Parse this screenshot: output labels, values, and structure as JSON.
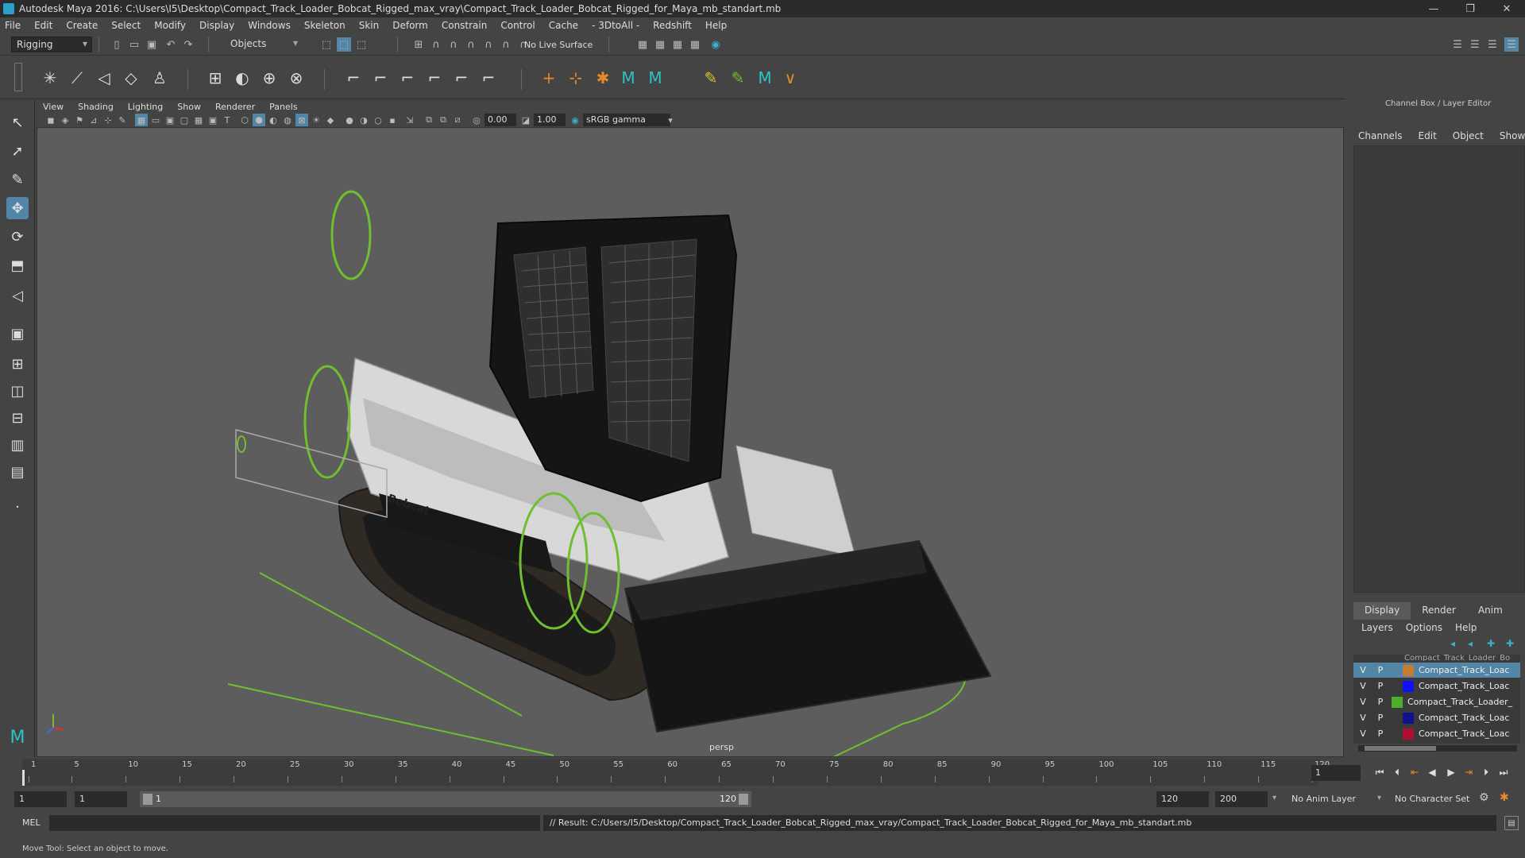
{
  "window": {
    "title": "Autodesk Maya 2016: C:\\Users\\I5\\Desktop\\Compact_Track_Loader_Bobcat_Rigged_max_vray\\Compact_Track_Loader_Bobcat_Rigged_for_Maya_mb_standart.mb",
    "controls": [
      "—",
      "❐",
      "✕"
    ]
  },
  "menubar": [
    "File",
    "Edit",
    "Create",
    "Select",
    "Modify",
    "Display",
    "Windows",
    "Skeleton",
    "Skin",
    "Deform",
    "Constrain",
    "Control",
    "Cache",
    "- 3DtoAll -",
    "Redshift",
    "Help"
  ],
  "statusline": {
    "menuset": "Rigging",
    "selection_mode": "Objects",
    "live_surface": "No Live Surface"
  },
  "panel": {
    "menu": [
      "View",
      "Shading",
      "Lighting",
      "Show",
      "Renderer",
      "Panels"
    ],
    "exposure": "0.00",
    "gamma": "1.00",
    "colorspace": "sRGB gamma",
    "camera": "persp"
  },
  "viewport": {
    "logo_text": "Bobcat"
  },
  "channelbox": {
    "header": "Channel Box / Layer Editor",
    "menu": [
      "Channels",
      "Edit",
      "Object",
      "Show"
    ]
  },
  "layereditor": {
    "tabs": [
      "Display",
      "Render",
      "Anim"
    ],
    "menu": [
      "Layers",
      "Options",
      "Help"
    ],
    "layers": [
      {
        "v": "V",
        "p": "P",
        "color": "#c87a32",
        "name": "Compact_Track_Loac",
        "selected": true
      },
      {
        "v": "V",
        "p": "P",
        "color": "#1010ff",
        "name": "Compact_Track_Loac",
        "selected": false
      },
      {
        "v": "V",
        "p": "P",
        "color": "#4caf2a",
        "name": "Compact_Track_Loader_",
        "selected": false
      },
      {
        "v": "V",
        "p": "P",
        "color": "#101090",
        "name": "Compact_Track_Loac",
        "selected": false
      },
      {
        "v": "V",
        "p": "P",
        "color": "#b01030",
        "name": "Compact_Track_Loac",
        "selected": false
      }
    ],
    "partial_row": "Compact_Track_Loader_Bo"
  },
  "timeslider": {
    "ticks": [
      "1",
      "5",
      "10",
      "15",
      "20",
      "25",
      "30",
      "35",
      "40",
      "45",
      "50",
      "55",
      "60",
      "65",
      "70",
      "75",
      "80",
      "85",
      "90",
      "95",
      "100",
      "105",
      "110",
      "115",
      "120"
    ],
    "current_frame": "1"
  },
  "range": {
    "start": "1",
    "playback_start": "1",
    "slider_start": "1",
    "slider_end": "120",
    "playback_end": "120",
    "end": "200",
    "anim_layer": "No Anim Layer",
    "character_set": "No Character Set"
  },
  "commandline": {
    "lang": "MEL",
    "result": "// Result: C:/Users/I5/Desktop/Compact_Track_Loader_Bobcat_Rigged_max_vray/Compact_Track_Loader_Bobcat_Rigged_for_Maya_mb_standart.mb"
  },
  "helpline": "Move Tool: Select an object to move.",
  "colors": {
    "accent": "#5285a6",
    "rig_green": "#6fbf2f",
    "viewport_bg": "#5d5d5d"
  }
}
